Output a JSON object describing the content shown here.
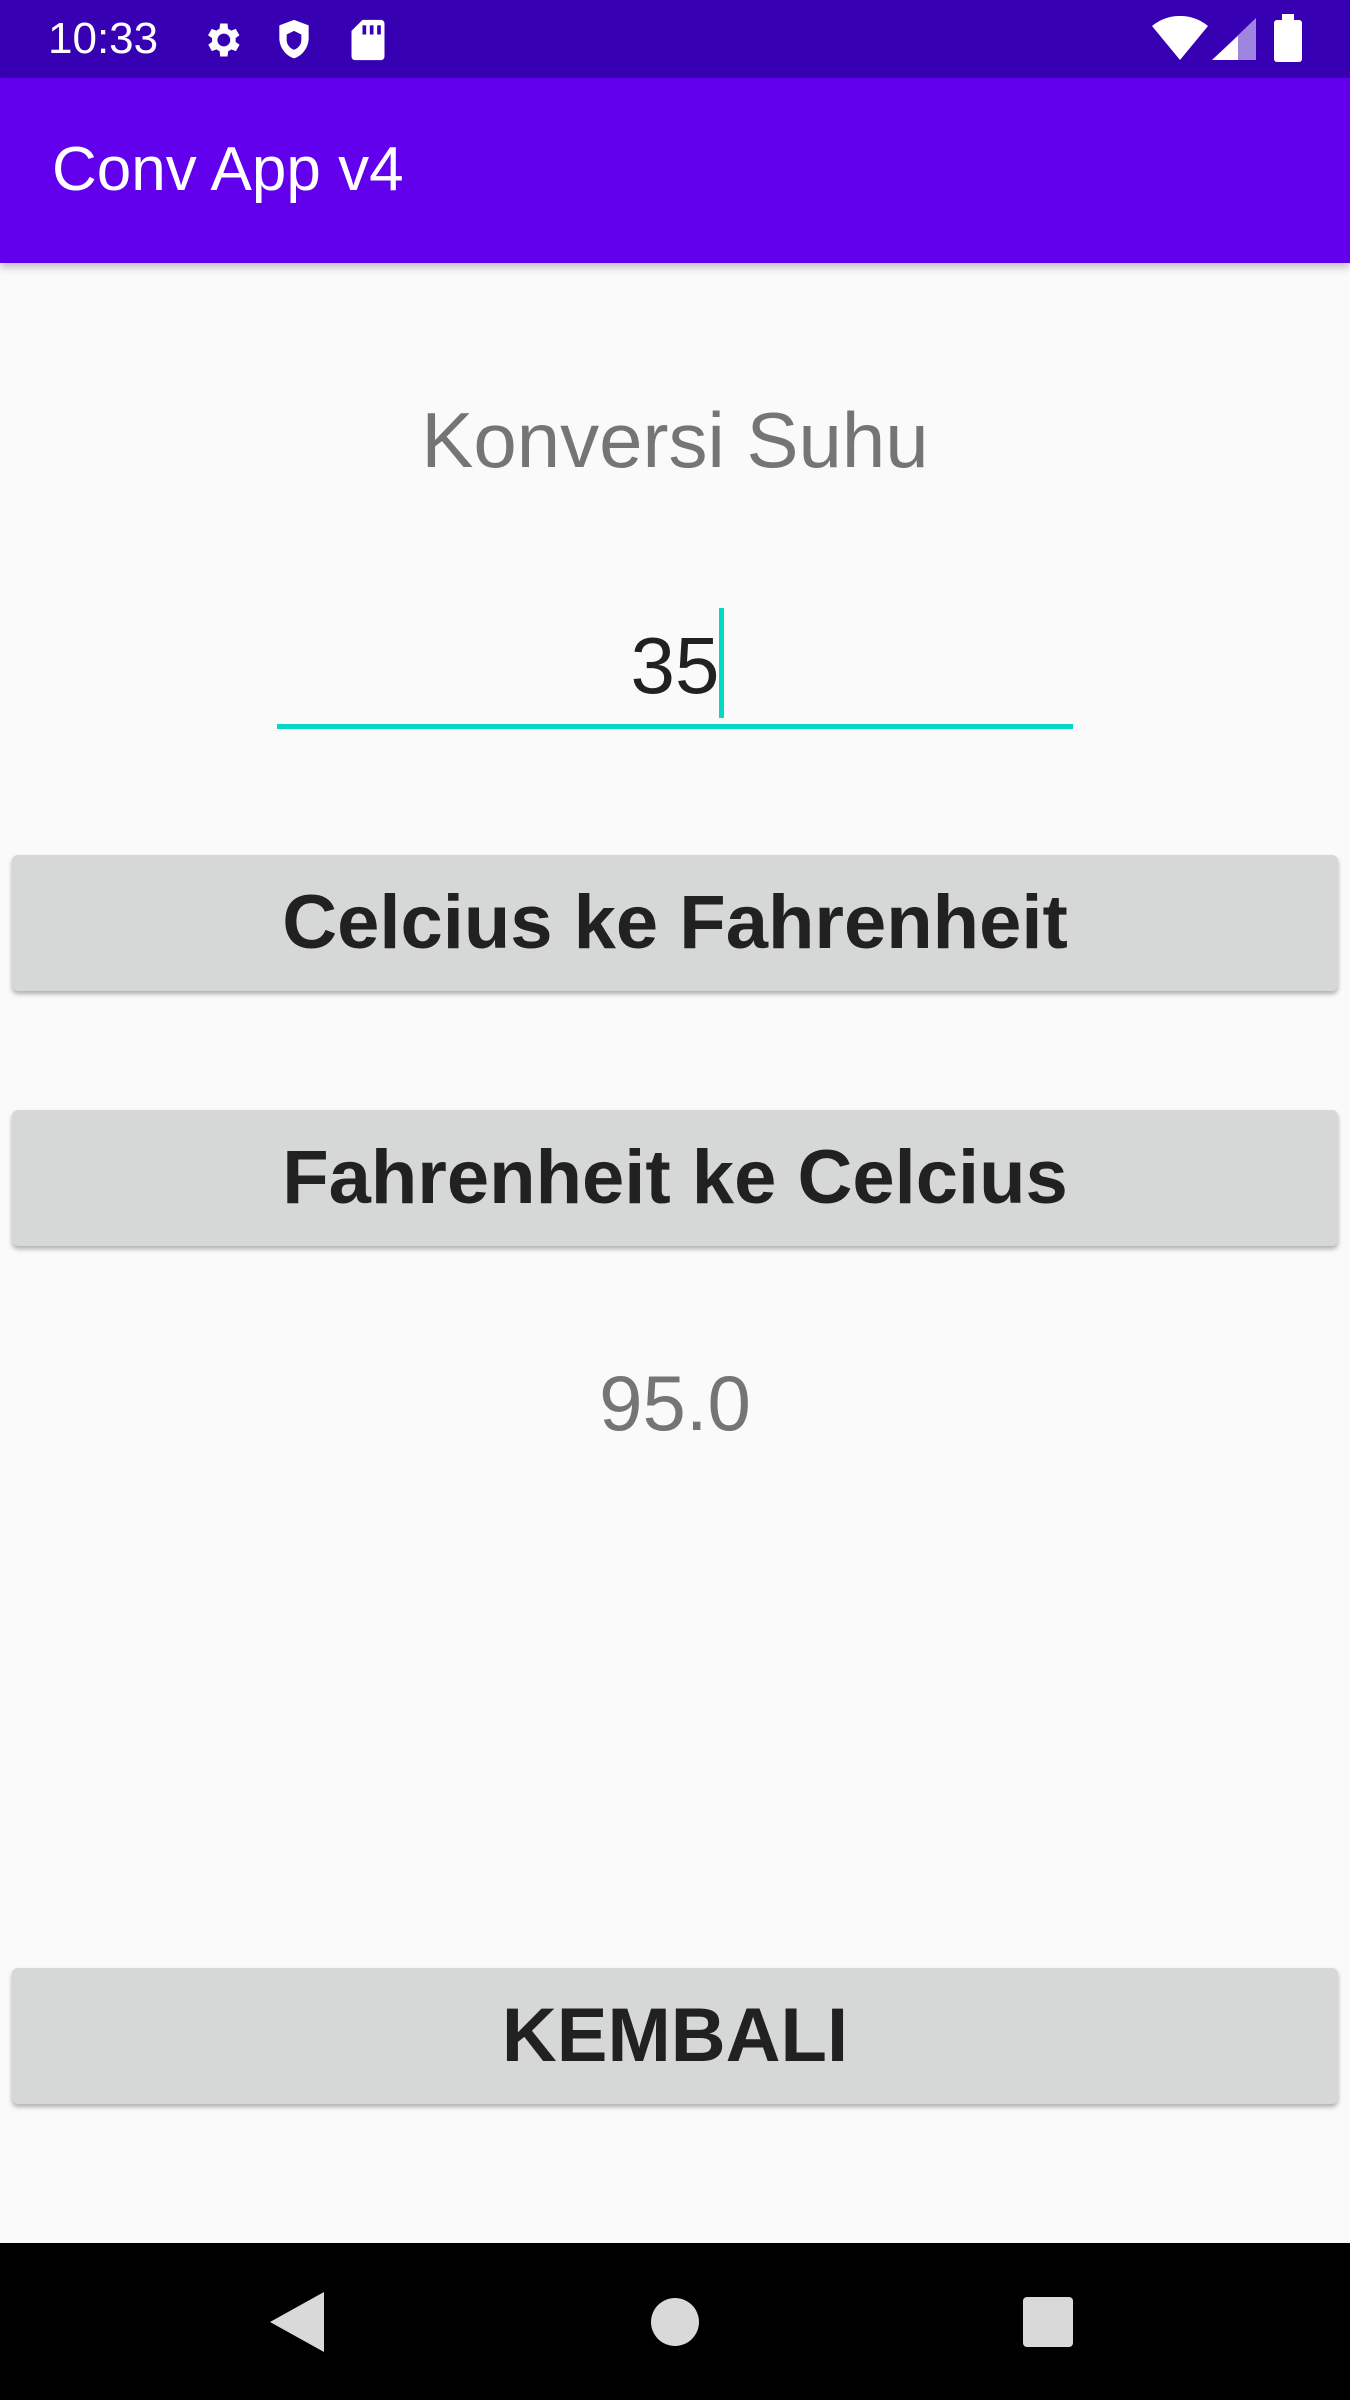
{
  "status_bar": {
    "time": "10:33",
    "icons": [
      "settings-icon",
      "shield-icon",
      "sd-card-icon",
      "wifi-icon",
      "cell-signal-icon",
      "battery-icon"
    ]
  },
  "app_bar": {
    "title": "Conv App v4",
    "color": "#6200ee"
  },
  "main": {
    "heading": "Konversi Suhu",
    "input_value": "35",
    "button_c2f": "Celcius ke Fahrenheit",
    "button_f2c": "Fahrenheit ke Celcius",
    "result": "95.0",
    "button_back": "KEMBALI"
  },
  "nav_bar": {
    "icons": [
      "back-icon",
      "home-icon",
      "recents-icon"
    ]
  },
  "colors": {
    "status_bar": "#3700b3",
    "accent": "#03dac5",
    "button_bg": "#d6d7d7"
  }
}
